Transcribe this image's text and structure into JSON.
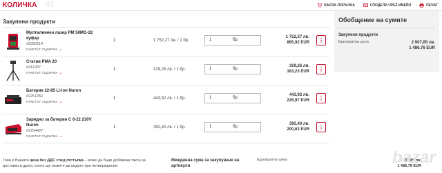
{
  "header": {
    "title": "КОЛИЧКА",
    "watermark": "97",
    "links": [
      {
        "label": "БЪРЗА ПОРЪЧКА",
        "icon": "cart-icon"
      },
      {
        "label": "СПОДЕЛИ ЧРЕЗ ИМЕЙЛ",
        "icon": "mail-icon"
      },
      {
        "label": "ПЕЧАТ",
        "icon": "print-icon"
      }
    ]
  },
  "section": {
    "title": "Закупени продукти"
  },
  "common": {
    "package_label": "ПАКЕТЪТ СЪДЪРЖА",
    "qty_unit": "бр.",
    "menu_glyph": "⋮"
  },
  "items": [
    {
      "name": "Мултилинеен лазер PM 50MG-22 куфар",
      "code": "#2390114",
      "qty": "1",
      "unit_price": "1 752,27 лв. / 1 бр.",
      "qty_value": "1",
      "total_bgn": "1 752,27 лв.",
      "total_eur": "895,92 EUR",
      "image": "laser-level"
    },
    {
      "name": "Статив PMA 20",
      "code": "#411287",
      "qty": "1",
      "unit_price": "319,26 лв. / 1 бр.",
      "qty_value": "1",
      "total_bgn": "319,26 лв.",
      "total_eur": "163,23 EUR",
      "image": "tripod"
    },
    {
      "name": "Батерия 22-85 Li-ion Nuron",
      "code": "#2251351",
      "qty": "1",
      "unit_price": "443,92 лв. / 1 бр.",
      "qty_value": "1",
      "total_bgn": "443,92 лв.",
      "total_eur": "226,97 EUR",
      "image": "battery"
    },
    {
      "name": "Зарядно за батерии C 6-22 230V Nuron",
      "code": "#2254427",
      "qty": "1",
      "unit_price": "392,40 лв. / 1 бр.",
      "qty_value": "1",
      "total_bgn": "392,40 лв.",
      "total_eur": "200,63 EUR",
      "image": "charger"
    }
  ],
  "footer": {
    "note_part1": "Това е Вашата ",
    "note_bold": "цена без ДДС след отстъпка",
    "note_part2": " – може да бъде добавена такса за доставка и други, които ще можете да видите при потвърждение.",
    "subtotal_label": "Междинна сума за закупуване на артикули",
    "subtotal_mode": "Еднократна цена",
    "subtotal_bgn": "2 907,85 лв.",
    "subtotal_eur": "1 486,76 EUR"
  },
  "sidebar": {
    "title": "Обобщение на сумите",
    "label": "Закупени продукти",
    "mode": "Еднократна цена",
    "total_bgn": "2 907,85 лв.",
    "total_eur": "1 486,76 EUR"
  },
  "logo": {
    "text": "bazar"
  },
  "colors": {
    "accent": "#c8102e",
    "sidebar_bg": "#f2f2f2",
    "border": "#e6e6e6"
  }
}
